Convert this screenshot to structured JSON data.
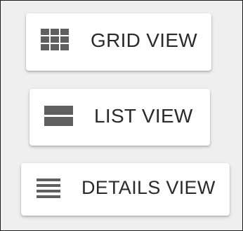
{
  "view_options": {
    "grid_label": "GRID VIEW",
    "list_label": "LIST VIEW",
    "details_label": "DETAILS VIEW"
  },
  "icons": {
    "grid": "grid-icon",
    "list": "list-icon",
    "details": "details-icon"
  },
  "colors": {
    "background": "#efefef",
    "button": "#ffffff",
    "text": "#2a2a2a",
    "icon": "#5f5f5f",
    "border": "#1c1c1c"
  }
}
